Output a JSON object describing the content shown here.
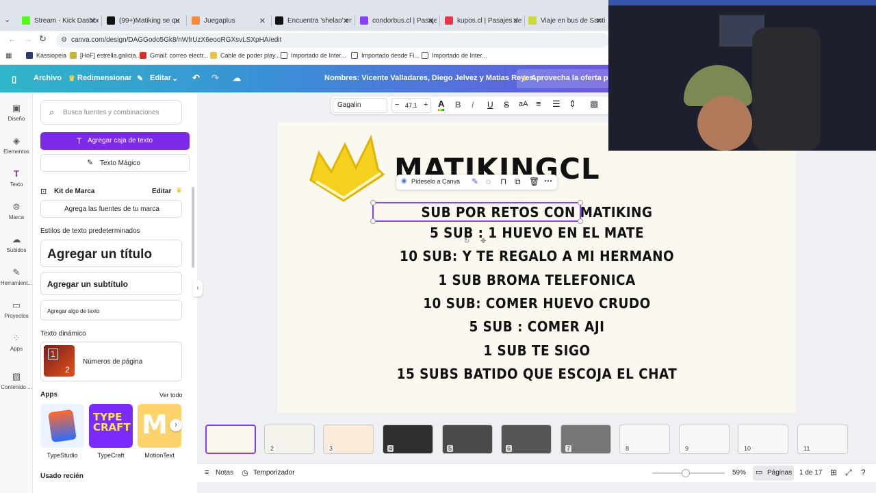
{
  "browser": {
    "tabs": [
      {
        "label": "Stream - Kick Dashbo",
        "color": "#53fc18"
      },
      {
        "label": "(99+)Matiking se qu",
        "color": "#111111"
      },
      {
        "label": "Juegaplus",
        "color": "#f28c38"
      },
      {
        "label": "Encuentra 'shelao' en",
        "color": "#111111"
      },
      {
        "label": "condorbus.cl | Pasaje",
        "color": "#8a3ffc"
      },
      {
        "label": "kupos.cl | Pasajes de",
        "color": "#e8334a"
      },
      {
        "label": "Viaje en bus de Santi",
        "color": "#c9d93a"
      }
    ],
    "url": "canva.com/design/DAGGodo5Gk8/nWfrUzX6eooRGXsvLSXpHA/edit",
    "bookmarks": [
      "Kassiopeia",
      "[HoF] estrella.galicia...",
      "Gmail: correo electr...",
      "Cable de poder play...",
      "Importado de Inter...",
      "Importado desde Fi...",
      "Importado de Inter..."
    ]
  },
  "header": {
    "archivo": "Archivo",
    "redimensionar": "Redimensionar",
    "editar": "Editar",
    "doc_title": "Nombres: Vicente Valladares, Diego Jelvez y Matias Reyes.",
    "offer": "Aprovecha la oferta para"
  },
  "rail": [
    {
      "label": "Diseño",
      "icon": "layout-icon"
    },
    {
      "label": "Elementos",
      "icon": "shapes-icon"
    },
    {
      "label": "Texto",
      "icon": "text-icon"
    },
    {
      "label": "Marca",
      "icon": "brand-icon"
    },
    {
      "label": "Subidos",
      "icon": "upload-icon"
    },
    {
      "label": "Herramient...",
      "icon": "tools-icon"
    },
    {
      "label": "Proyectos",
      "icon": "folder-icon"
    },
    {
      "label": "Apps",
      "icon": "apps-icon"
    },
    {
      "label": "Contenido ...",
      "icon": "content-icon"
    }
  ],
  "panel": {
    "search_placeholder": "Busca fuentes y combinaciones",
    "add_textbox": "Agregar caja de texto",
    "magic_text": "Texto Mágico",
    "brand_kit": "Kit de Marca",
    "brand_edit": "Editar",
    "brand_fonts": "Agrega las fuentes de tu marca",
    "default_styles": "Estilos de texto predeterminados",
    "add_title": "Agregar un título",
    "add_subtitle": "Agregar un subtítulo",
    "add_body": "Agregar algo de texto",
    "dynamic_text": "Texto dinámico",
    "page_numbers": "Números de página",
    "apps": "Apps",
    "see_all": "Ver todo",
    "app_names": [
      "TypeStudio",
      "TypeCraft",
      "MotionText"
    ],
    "recent": "Usado recién"
  },
  "toolbar": {
    "font": "Gagalin",
    "size": "47,1"
  },
  "canvas": {
    "heading": "MATIKINGCL",
    "ask_canva": "Pídeselo a Canva",
    "lines": [
      "SUB POR RETOS CON MATIKING",
      "5 SUB : 1 HUEVO EN EL MATE",
      "10 SUB: Y TE REGALO A MI HERMANO",
      "1 SUB BROMA TELEFONICA",
      "10 SUB: COMER HUEVO CRUDO",
      "5 SUB : COMER AJI",
      "1 SUB TE SIGO",
      "15 SUBS BATIDO QUE ESCOJA EL CHAT"
    ]
  },
  "thumbnails": [
    "",
    "2",
    "3",
    "4",
    "5",
    "6",
    "7",
    "8",
    "9",
    "10",
    "11"
  ],
  "bottom": {
    "notes": "Notas",
    "timer": "Temporizador",
    "zoom": "59%",
    "pages": "Páginas",
    "page_count": "1 de 17"
  }
}
